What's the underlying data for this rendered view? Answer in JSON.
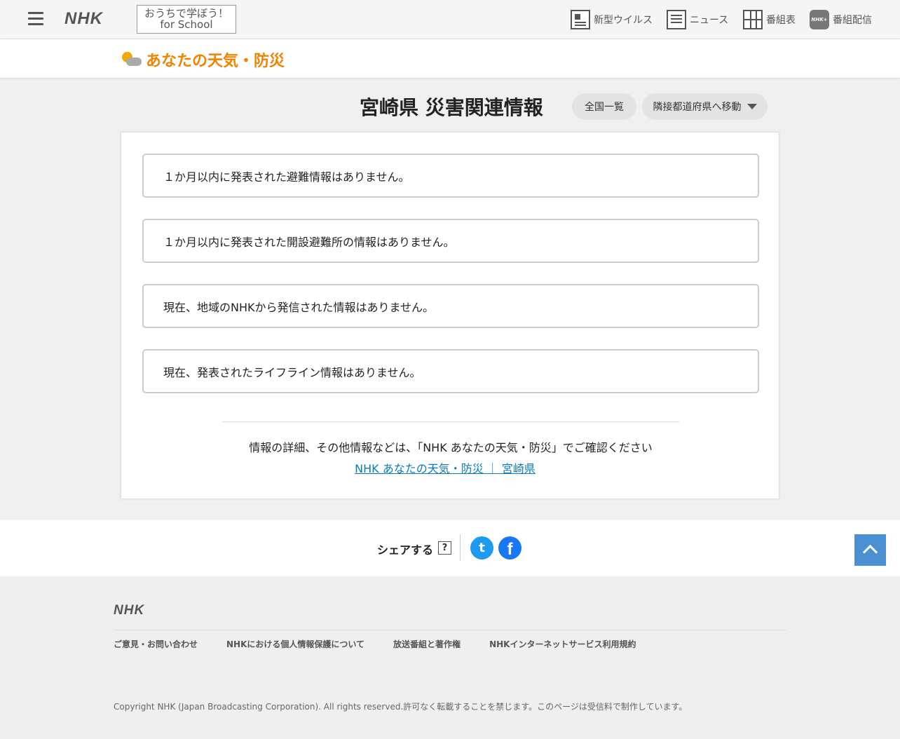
{
  "topbar": {
    "logo": "NHK",
    "school_btn": {
      "line1": "おうちで学ぼう！",
      "line2": "for School"
    },
    "nav": [
      {
        "label": "新型ウイルス",
        "icon": "virus-info-icon"
      },
      {
        "label": "ニュース",
        "icon": "news-icon"
      },
      {
        "label": "番組表",
        "icon": "program-guide-icon"
      },
      {
        "label": "番組配信",
        "icon": "nhk-plus-icon"
      }
    ],
    "plus_icon_text": "NHK+"
  },
  "subheader": {
    "brand": "あなたの天気・防災",
    "icon": "sun-cloud-icon"
  },
  "main": {
    "title": "宮崎県 災害関連情報",
    "btn_all": "全国一覧",
    "btn_move": "隣接都道府県へ移動",
    "messages": [
      "１か月以内に発表された避難情報はありません。",
      "１か月以内に発表された開設避難所の情報はありません。",
      "現在、地域のNHKから発信された情報はありません。",
      "現在、発表されたライフライン情報はありません。"
    ],
    "note": "情報の詳細、その他情報などは、「NHK あなたの天気・防災」でご確認ください",
    "link": "NHK あなたの天気・防災 ｜ 宮崎県"
  },
  "share": {
    "label": "シェアする",
    "help": "?",
    "twitter_glyph": "t",
    "facebook_glyph": "f"
  },
  "footer": {
    "logo": "NHK",
    "links": [
      "ご意見・お問い合わせ",
      "NHKにおける個人情報保護について",
      "放送番組と著作権",
      "NHKインターネットサービス利用規約"
    ],
    "copyright": "Copyright NHK (Japan Broadcasting Corporation). All rights reserved.許可なく転載することを禁じます。このページは受信料で制作しています。"
  },
  "colors": {
    "brand_orange": "#f08300",
    "link_blue": "#0b7cba",
    "to_top_blue": "#4a90d2",
    "twitter": "#1d9bf0",
    "facebook": "#1877f2"
  }
}
